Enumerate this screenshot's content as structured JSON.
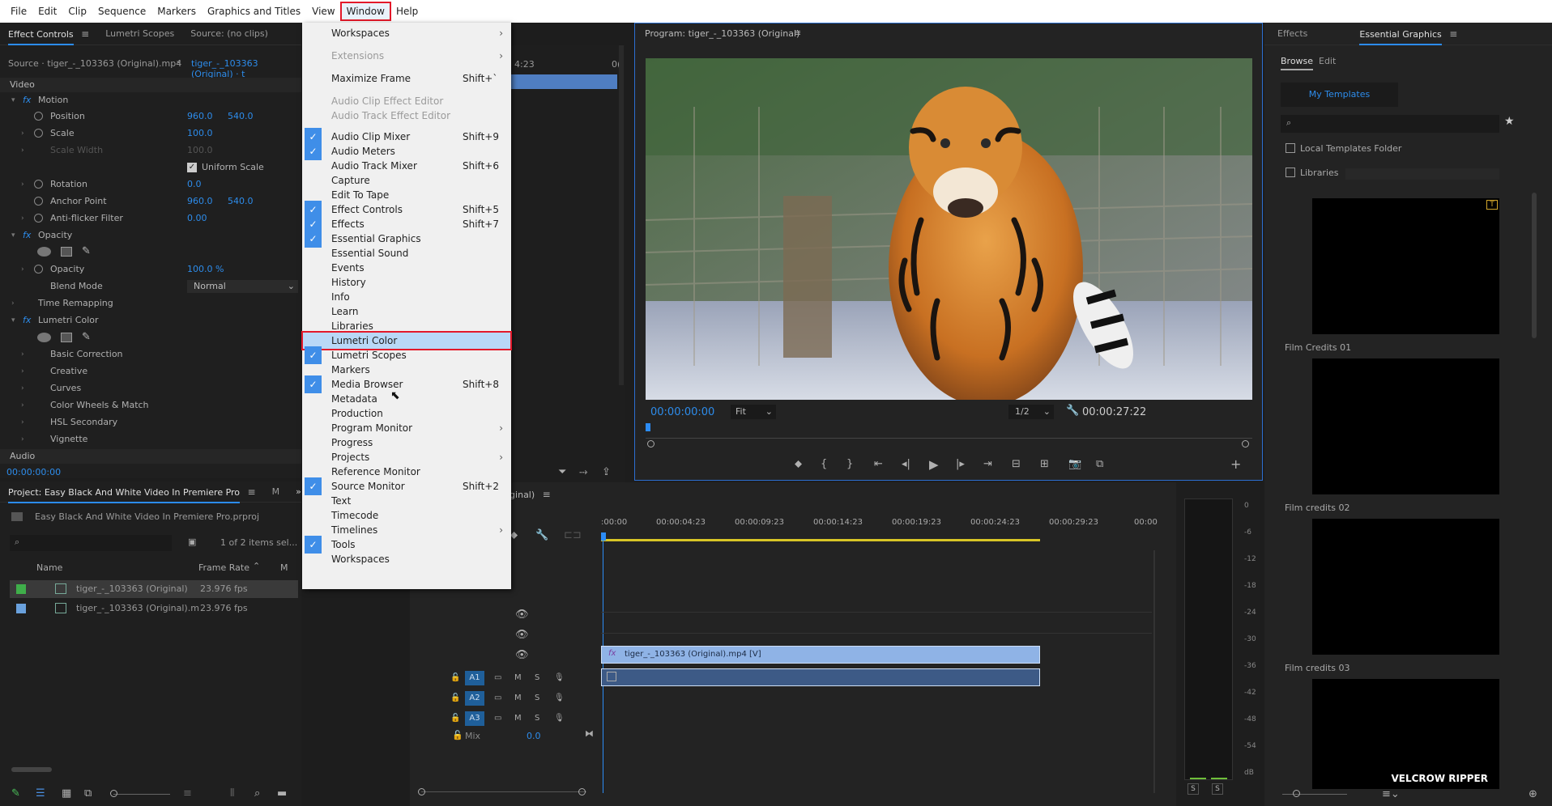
{
  "menubar": {
    "items": [
      "File",
      "Edit",
      "Clip",
      "Sequence",
      "Markers",
      "Graphics and Titles",
      "View",
      "Window",
      "Help"
    ]
  },
  "effect_controls": {
    "tabs": [
      "Effect Controls",
      "Lumetri Scopes",
      "Source: (no clips)"
    ],
    "source_line": "Source · tiger_-_103363 (Original).mp4",
    "sequence_line": "tiger_-_103363 (Original) · t",
    "video_header": "Video",
    "motion": "Motion",
    "position_label": "Position",
    "position_x": "960.0",
    "position_y": "540.0",
    "scale_label": "Scale",
    "scale_value": "100.0",
    "scale_width_label": "Scale Width",
    "scale_width_value": "100.0",
    "uniform_scale": "Uniform Scale",
    "rotation_label": "Rotation",
    "rotation_value": "0.0",
    "anchor_label": "Anchor Point",
    "anchor_x": "960.0",
    "anchor_y": "540.0",
    "antiflicker_label": "Anti-flicker Filter",
    "antiflicker_value": "0.00",
    "opacity_section": "Opacity",
    "opacity_label": "Opacity",
    "opacity_value": "100.0 %",
    "blend_label": "Blend Mode",
    "blend_value": "Normal",
    "time_remap": "Time Remapping",
    "lumetri": "Lumetri Color",
    "basic": "Basic Correction",
    "creative": "Creative",
    "curves": "Curves",
    "wheels": "Color Wheels & Match",
    "hsl": "HSL Secondary",
    "vignette": "Vignette",
    "audio_header": "Audio",
    "timecode": "00:00:00:00"
  },
  "project": {
    "title": "Project: Easy Black And White Video In Premiere Pro",
    "tab2": "M",
    "file": "Easy Black And White Video In Premiere Pro.prproj",
    "items_count": "1 of 2 items sel...",
    "col_name": "Name",
    "col_fps": "Frame Rate",
    "col_m": "M",
    "rows": [
      {
        "name": "tiger_-_103363 (Original)",
        "fps": "23.976 fps",
        "color": "#3fae4a"
      },
      {
        "name": "tiger_-_103363 (Original).m",
        "fps": "23.976 fps",
        "color": "#6aa1dd"
      }
    ]
  },
  "window_menu": {
    "items": [
      {
        "label": "Workspaces",
        "shortcut": "",
        "checked": false,
        "submenu": true,
        "disabled": false
      },
      {
        "label": "Extensions",
        "shortcut": "",
        "checked": false,
        "submenu": true,
        "disabled": true
      },
      {
        "label": "Maximize Frame",
        "shortcut": "Shift+`",
        "checked": false,
        "submenu": false,
        "disabled": false
      },
      {
        "label": "Audio Clip Effect Editor",
        "shortcut": "",
        "checked": false,
        "submenu": false,
        "disabled": true
      },
      {
        "label": "Audio Track Effect Editor",
        "shortcut": "",
        "checked": false,
        "submenu": false,
        "disabled": true
      },
      {
        "label": "Audio Clip Mixer",
        "shortcut": "Shift+9",
        "checked": true,
        "submenu": false,
        "disabled": false
      },
      {
        "label": "Audio Meters",
        "shortcut": "",
        "checked": true,
        "submenu": false,
        "disabled": false
      },
      {
        "label": "Audio Track Mixer",
        "shortcut": "Shift+6",
        "checked": false,
        "submenu": false,
        "disabled": false
      },
      {
        "label": "Capture",
        "shortcut": "",
        "checked": false,
        "submenu": false,
        "disabled": false
      },
      {
        "label": "Edit To Tape",
        "shortcut": "",
        "checked": false,
        "submenu": false,
        "disabled": false
      },
      {
        "label": "Effect Controls",
        "shortcut": "Shift+5",
        "checked": true,
        "submenu": false,
        "disabled": false
      },
      {
        "label": "Effects",
        "shortcut": "Shift+7",
        "checked": true,
        "submenu": false,
        "disabled": false
      },
      {
        "label": "Essential Graphics",
        "shortcut": "",
        "checked": true,
        "submenu": false,
        "disabled": false
      },
      {
        "label": "Essential Sound",
        "shortcut": "",
        "checked": false,
        "submenu": false,
        "disabled": false
      },
      {
        "label": "Events",
        "shortcut": "",
        "checked": false,
        "submenu": false,
        "disabled": false
      },
      {
        "label": "History",
        "shortcut": "",
        "checked": false,
        "submenu": false,
        "disabled": false
      },
      {
        "label": "Info",
        "shortcut": "",
        "checked": false,
        "submenu": false,
        "disabled": false
      },
      {
        "label": "Learn",
        "shortcut": "",
        "checked": false,
        "submenu": false,
        "disabled": false
      },
      {
        "label": "Libraries",
        "shortcut": "",
        "checked": false,
        "submenu": false,
        "disabled": false
      },
      {
        "label": "Lumetri Color",
        "shortcut": "",
        "checked": false,
        "submenu": false,
        "disabled": false,
        "highlighted": true
      },
      {
        "label": "Lumetri Scopes",
        "shortcut": "",
        "checked": true,
        "submenu": false,
        "disabled": false
      },
      {
        "label": "Markers",
        "shortcut": "",
        "checked": false,
        "submenu": false,
        "disabled": false
      },
      {
        "label": "Media Browser",
        "shortcut": "Shift+8",
        "checked": true,
        "submenu": false,
        "disabled": false
      },
      {
        "label": "Metadata",
        "shortcut": "",
        "checked": false,
        "submenu": false,
        "disabled": false
      },
      {
        "label": "Production",
        "shortcut": "",
        "checked": false,
        "submenu": false,
        "disabled": false
      },
      {
        "label": "Program Monitor",
        "shortcut": "",
        "checked": false,
        "submenu": true,
        "disabled": false
      },
      {
        "label": "Progress",
        "shortcut": "",
        "checked": false,
        "submenu": false,
        "disabled": false
      },
      {
        "label": "Projects",
        "shortcut": "",
        "checked": false,
        "submenu": true,
        "disabled": false
      },
      {
        "label": "Reference Monitor",
        "shortcut": "",
        "checked": false,
        "submenu": false,
        "disabled": false
      },
      {
        "label": "Source Monitor",
        "shortcut": "Shift+2",
        "checked": true,
        "submenu": false,
        "disabled": false
      },
      {
        "label": "Text",
        "shortcut": "",
        "checked": false,
        "submenu": false,
        "disabled": false
      },
      {
        "label": "Timecode",
        "shortcut": "",
        "checked": false,
        "submenu": false,
        "disabled": false
      },
      {
        "label": "Timelines",
        "shortcut": "",
        "checked": false,
        "submenu": true,
        "disabled": false
      },
      {
        "label": "Tools",
        "shortcut": "",
        "checked": true,
        "submenu": false,
        "disabled": false
      },
      {
        "label": "Workspaces",
        "shortcut": "",
        "checked": false,
        "submenu": false,
        "disabled": false
      }
    ]
  },
  "program": {
    "title": "Program: tiger_-_103363 (Original)",
    "timecode": "00:00:00:00",
    "fit": "Fit",
    "resolution": "1/2",
    "duration": "00:00:27:22"
  },
  "timeline": {
    "tab_fragment": "iginal)",
    "ruler": [
      ":00:00",
      "00:00:04:23",
      "00:00:09:23",
      "00:00:14:23",
      "00:00:19:23",
      "00:00:24:23",
      "00:00:29:23",
      "00:00"
    ],
    "video_clip": "tiger_-_103363 (Original).mp4 [V]",
    "audio_tracks": [
      "A1",
      "A2",
      "A3"
    ],
    "mix_label": "Mix",
    "mix_value": "0.0",
    "m": "M",
    "s": "S"
  },
  "meters": {
    "scale": [
      "0",
      "-6",
      "-12",
      "-18",
      "-24",
      "-30",
      "-36",
      "-42",
      "-48",
      "-54",
      "dB"
    ],
    "solo": [
      "S",
      "S"
    ]
  },
  "essential_graphics": {
    "tabs": [
      "Effects",
      "Essential Graphics"
    ],
    "subtabs": [
      "Browse",
      "Edit"
    ],
    "my_templates": "My Templates",
    "local_templates": "Local Templates Folder",
    "libraries": "Libraries",
    "templates": [
      "Film Credits 01",
      "Film credits 02",
      "Film credits 03"
    ],
    "thumb4_text": "VELCROW RIPPER"
  },
  "source_monitor": {
    "timecode_fragment": "4:23",
    "zero": "0("
  }
}
